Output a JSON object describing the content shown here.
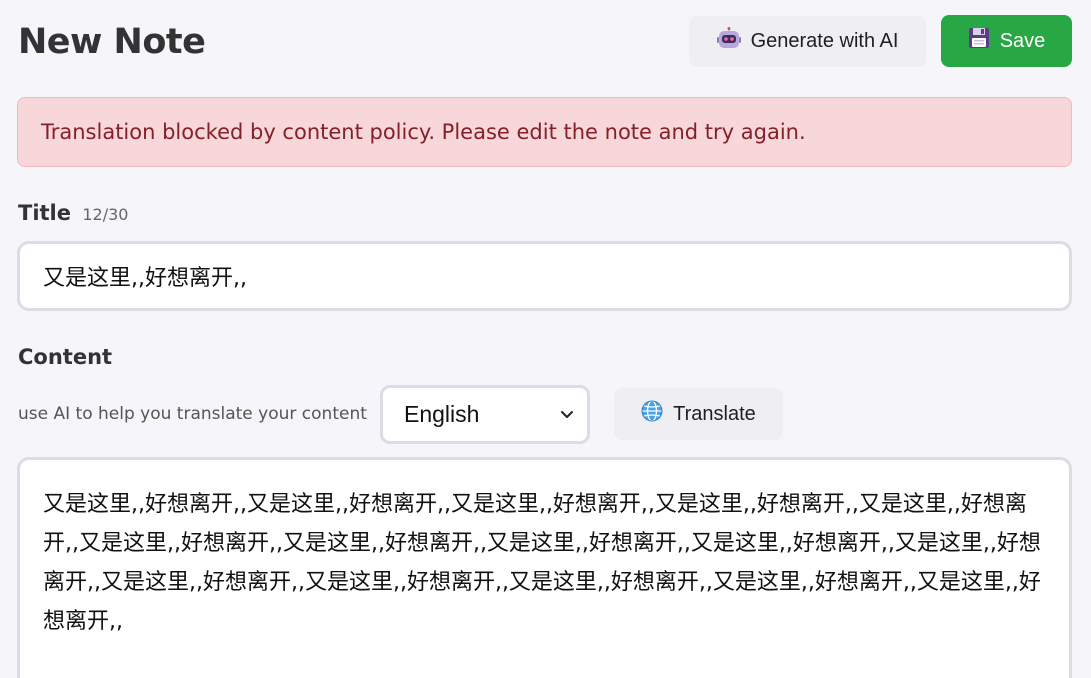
{
  "header": {
    "title": "New Note",
    "generate_label": "Generate with AI",
    "generate_icon": "robot-icon",
    "save_label": "Save",
    "save_icon": "floppy-disk-icon"
  },
  "alert": {
    "message": "Translation blocked by content policy. Please edit the note and try again."
  },
  "title_field": {
    "label": "Title",
    "counter": "12/30",
    "value": "又是这里,,好想离开,,"
  },
  "content_field": {
    "label": "Content",
    "helper": "use AI to help you translate your content",
    "language_selected": "English",
    "translate_label": "Translate",
    "translate_icon": "globe-icon",
    "value": "又是这里,,好想离开,,又是这里,,好想离开,,又是这里,,好想离开,,又是这里,,好想离开,,又是这里,,好想离开,,又是这里,,好想离开,,又是这里,,好想离开,,又是这里,,好想离开,,又是这里,,好想离开,,又是这里,,好想离开,,又是这里,,好想离开,,又是这里,,好想离开,,又是这里,,好想离开,,又是这里,,好想离开,,又是这里,,好想离开,,"
  },
  "colors": {
    "save_bg": "#28a745",
    "alert_bg": "#f8d7da",
    "alert_text": "#842029",
    "page_bg": "#f5f5fa"
  }
}
